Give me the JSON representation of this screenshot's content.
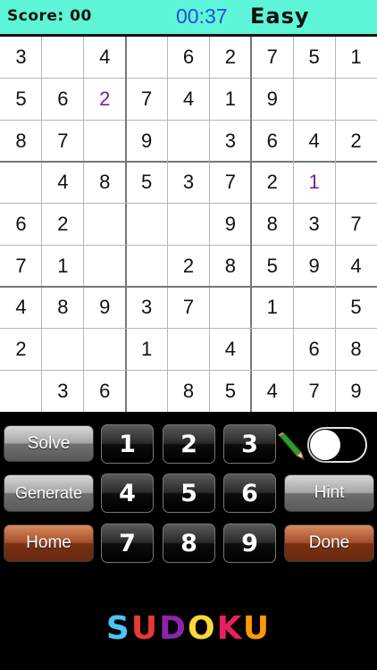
{
  "header": {
    "score_label": "Score: 00",
    "timer": "00:37",
    "difficulty": "Easy",
    "background_color": "#5cf5d8",
    "timer_color": "#2a4dd6"
  },
  "board": {
    "givens_color": "#111111",
    "user_entry_color": "#7b1fa2",
    "rows": [
      [
        "3",
        "",
        "4",
        "",
        "6",
        "2",
        "7",
        "5",
        "1"
      ],
      [
        "5",
        "6",
        "2",
        "7",
        "4",
        "1",
        "9",
        "",
        ""
      ],
      [
        "8",
        "7",
        "",
        "9",
        "",
        "3",
        "6",
        "4",
        "2"
      ],
      [
        "",
        "4",
        "8",
        "5",
        "3",
        "7",
        "2",
        "1",
        ""
      ],
      [
        "6",
        "2",
        "",
        "",
        "",
        "9",
        "8",
        "3",
        "7"
      ],
      [
        "7",
        "1",
        "",
        "",
        "2",
        "8",
        "5",
        "9",
        "4"
      ],
      [
        "4",
        "8",
        "9",
        "3",
        "7",
        "",
        "1",
        "",
        "5"
      ],
      [
        "2",
        "",
        "",
        "1",
        "",
        "4",
        "",
        "6",
        "8"
      ],
      [
        "",
        "3",
        "6",
        "",
        "8",
        "5",
        "4",
        "7",
        "9"
      ]
    ],
    "user_entries": [
      [
        1,
        2
      ],
      [
        3,
        7
      ]
    ]
  },
  "controls": {
    "solve_label": "Solve",
    "generate_label": "Generate",
    "home_label": "Home",
    "hint_label": "Hint",
    "done_label": "Done",
    "numbers": [
      "1",
      "2",
      "3",
      "4",
      "5",
      "6",
      "7",
      "8",
      "9"
    ],
    "pencil_icon": "pencil-icon",
    "pencil_mode_on": false
  },
  "title": {
    "letters": [
      {
        "char": "S",
        "color": "#4fc3f7"
      },
      {
        "char": "U",
        "color": "#e53935"
      },
      {
        "char": "D",
        "color": "#8e24aa"
      },
      {
        "char": "O",
        "color": "#fdd835"
      },
      {
        "char": "K",
        "color": "#e91e63"
      },
      {
        "char": "U",
        "color": "#ff9800"
      }
    ]
  }
}
